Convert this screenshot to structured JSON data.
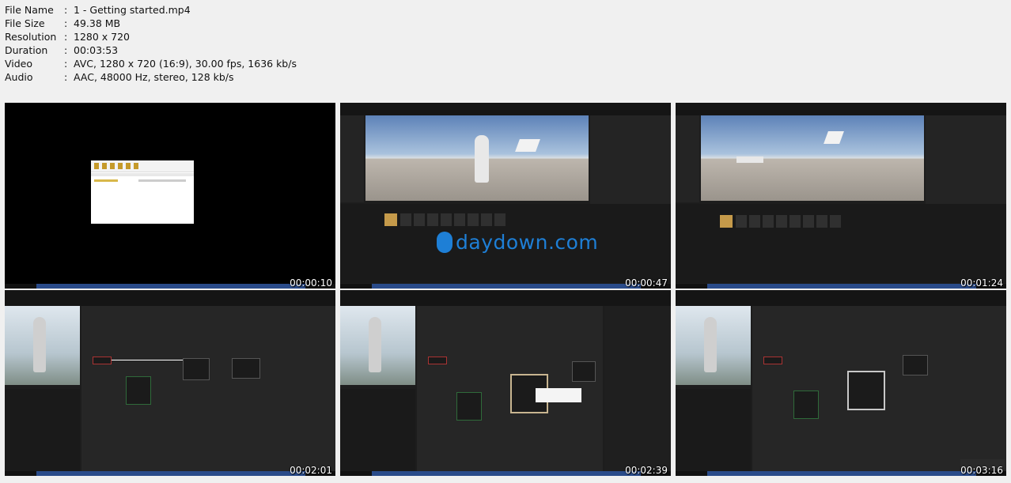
{
  "file_info": {
    "rows": [
      {
        "key": "File Name",
        "value": "1 - Getting started.mp4"
      },
      {
        "key": "File Size",
        "value": "49.38 MB"
      },
      {
        "key": "Resolution",
        "value": "1280 x 720"
      },
      {
        "key": "Duration",
        "value": "00:03:53"
      },
      {
        "key": "Video",
        "value": "AVC, 1280 x 720 (16:9), 30.00 fps, 1636 kb/s"
      },
      {
        "key": "Audio",
        "value": "AAC, 48000 Hz, stereo, 128 kb/s"
      }
    ],
    "separator": ":"
  },
  "thumbnails": [
    {
      "timestamp": "00:00:10",
      "kind": "explorer"
    },
    {
      "timestamp": "00:00:47",
      "kind": "level-editor-character"
    },
    {
      "timestamp": "00:01:24",
      "kind": "level-editor"
    },
    {
      "timestamp": "00:02:01",
      "kind": "control-rig"
    },
    {
      "timestamp": "00:02:39",
      "kind": "control-rig-popup"
    },
    {
      "timestamp": "00:03:16",
      "kind": "control-rig-selected"
    }
  ],
  "watermark": "daydown.com",
  "colors": {
    "background": "#f0f0f0",
    "watermark": "#1e7fd6",
    "editor": "#1d1d1d"
  }
}
